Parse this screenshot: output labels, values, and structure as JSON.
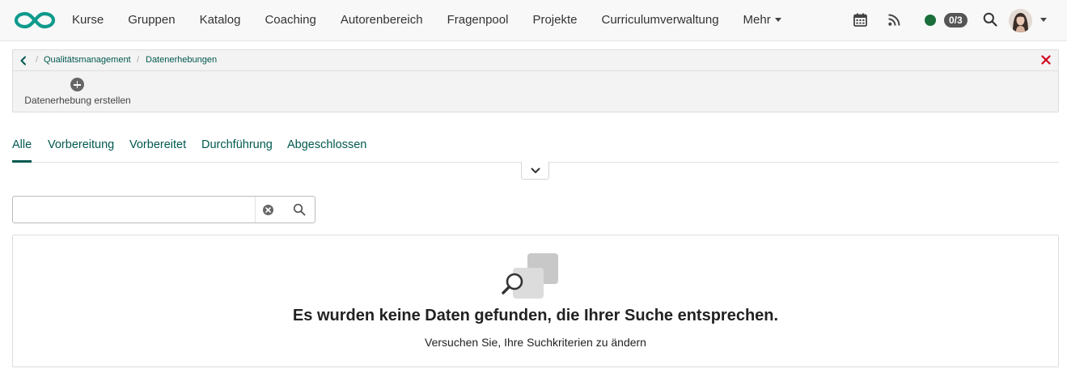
{
  "navbar": {
    "logo_icon": "infinity-logo-icon",
    "items": [
      {
        "label": "Kurse"
      },
      {
        "label": "Gruppen"
      },
      {
        "label": "Katalog"
      },
      {
        "label": "Coaching"
      },
      {
        "label": "Autorenbereich"
      },
      {
        "label": "Fragenpool"
      },
      {
        "label": "Projekte"
      },
      {
        "label": "Curriculumverwaltung"
      },
      {
        "label": "Mehr"
      }
    ],
    "icons": [
      "calendar-icon",
      "rss-icon",
      "search-icon",
      "chevron-down-icon"
    ],
    "status_color": "#1a6e3a",
    "badge": "0/3"
  },
  "breadcrumb": {
    "items": [
      {
        "label": "Qualitätsmanagement"
      },
      {
        "label": "Datenerhebungen"
      }
    ],
    "separator": "/",
    "close_color": "#d0021b"
  },
  "toolbar": {
    "create_label": "Datenerhebung erstellen"
  },
  "tabs": [
    {
      "label": "Alle",
      "active": true
    },
    {
      "label": "Vorbereitung",
      "active": false
    },
    {
      "label": "Vorbereitet",
      "active": false
    },
    {
      "label": "Durchführung",
      "active": false
    },
    {
      "label": "Abgeschlossen",
      "active": false
    }
  ],
  "search": {
    "value": "",
    "placeholder": ""
  },
  "empty_state": {
    "title": "Es wurden keine Daten gefunden, die Ihrer Suche entsprechen.",
    "subtitle": "Versuchen Sie, Ihre Suchkriterien zu ändern"
  },
  "colors": {
    "accent": "#00594f",
    "logo": "#0f9a8c"
  }
}
